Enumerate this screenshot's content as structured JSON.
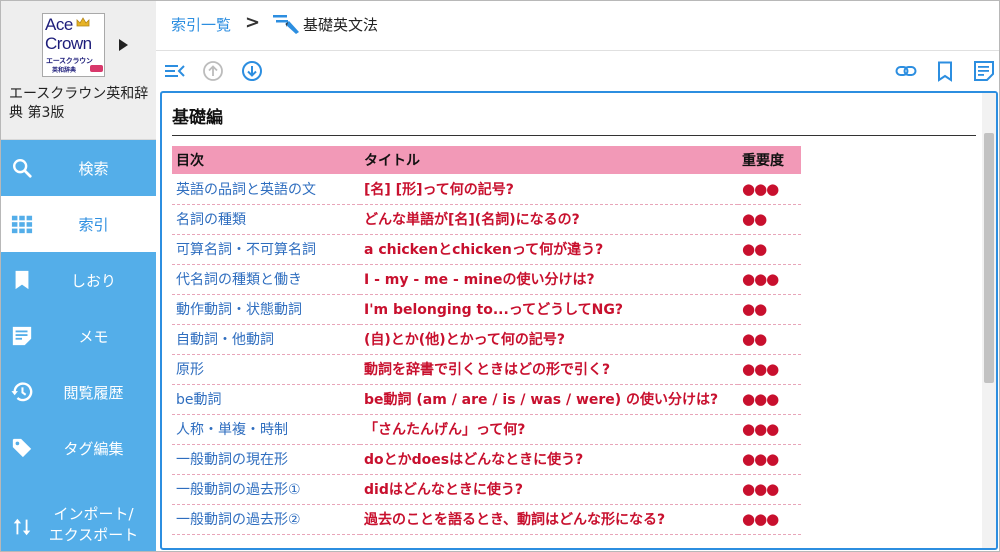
{
  "sidebar": {
    "logo": {
      "line1": "Ace",
      "line2": "Crown",
      "sub": "エースクラウン",
      "sub2": "英和辞典"
    },
    "book_title": "エースクラウン英和辞典 第3版",
    "items": [
      {
        "label": "検索",
        "icon": "search-icon"
      },
      {
        "label": "索引",
        "icon": "grid-icon",
        "active": true
      },
      {
        "label": "しおり",
        "icon": "bookmark-icon"
      },
      {
        "label": "メモ",
        "icon": "memo-icon"
      },
      {
        "label": "閲覧履歴",
        "icon": "history-icon"
      },
      {
        "label": "タグ編集",
        "icon": "tag-icon"
      },
      {
        "label_line1": "インポート/",
        "label_line2": "エクスポート",
        "icon": "import-export-icon"
      }
    ]
  },
  "header": {
    "breadcrumb_root": "索引一覧",
    "breadcrumb_sep": ">",
    "breadcrumb_current": "基礎英文法"
  },
  "toolbar": {
    "left": [
      "collapse-list-icon",
      "arrow-up-circle-icon",
      "arrow-down-circle-icon"
    ],
    "right": [
      "link-icon",
      "bookmark-outline-icon",
      "memo-outline-icon"
    ]
  },
  "content": {
    "section_title": "基礎編",
    "columns": {
      "toc": "目次",
      "title": "タイトル",
      "importance": "重要度"
    },
    "rows": [
      {
        "toc": "英語の品詞と英語の文",
        "title": "[名] [形]って何の記号?",
        "importance": "●●●"
      },
      {
        "toc": "名詞の種類",
        "title": "どんな単語が[名](名詞)になるの?",
        "importance": "●●"
      },
      {
        "toc": "可算名詞・不可算名詞",
        "title": "a chickenとchickenって何が違う?",
        "importance": "●●"
      },
      {
        "toc": "代名詞の種類と働き",
        "title": "I - my - me - mineの使い分けは?",
        "importance": "●●●"
      },
      {
        "toc": "動作動詞・状態動詞",
        "title": "I'm belonging to...ってどうしてNG?",
        "importance": "●●"
      },
      {
        "toc": "自動詞・他動詞",
        "title": "(自)とか(他)とかって何の記号?",
        "importance": "●●"
      },
      {
        "toc": "原形",
        "title": "動詞を辞書で引くときはどの形で引く?",
        "importance": "●●●"
      },
      {
        "toc": "be動詞",
        "title": "be動詞 (am / are / is / was / were) の使い分けは?",
        "importance": "●●●"
      },
      {
        "toc": "人称・単複・時制",
        "title": "「さんたんげん」って何?",
        "importance": "●●●"
      },
      {
        "toc": "一般動詞の現在形",
        "title": "doとかdoesはどんなときに使う?",
        "importance": "●●●"
      },
      {
        "toc": "一般動詞の過去形①",
        "title": "didはどんなときに使う?",
        "importance": "●●●"
      },
      {
        "toc": "一般動詞の過去形②",
        "title": "過去のことを語るとき、動詞はどんな形になる?",
        "importance": "●●●"
      }
    ]
  },
  "colors": {
    "sidebar": "#54aee9",
    "accent": "#2c8ee0",
    "table_header": "#f299b7",
    "title_red": "#c8102e",
    "toc_blue": "#2f6ebf"
  }
}
